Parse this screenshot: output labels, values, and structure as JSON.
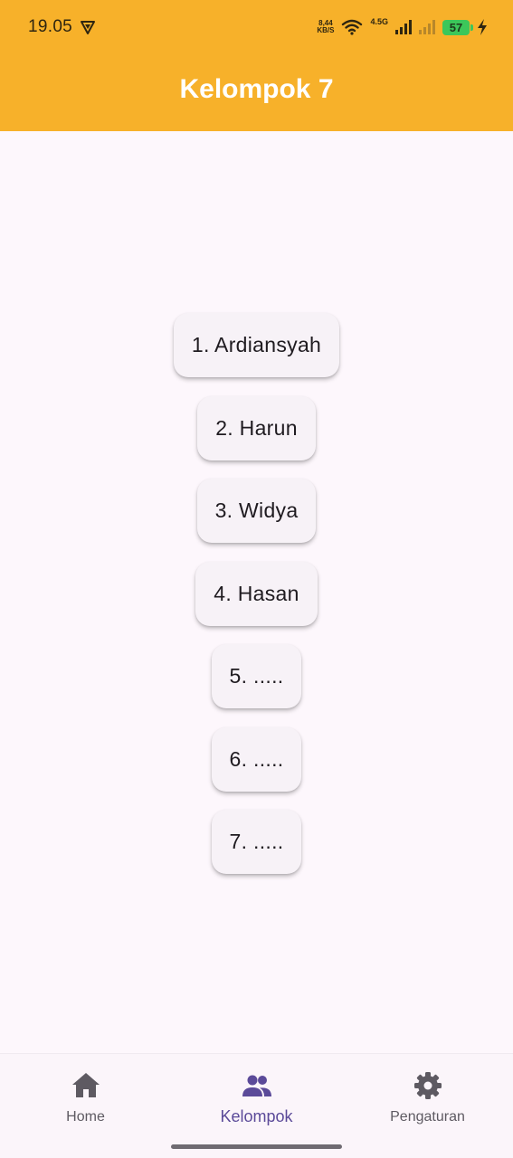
{
  "status_bar": {
    "time": "19.05",
    "net_speed_value": "8,44",
    "net_speed_unit": "KB/S",
    "network_type": "4.5G",
    "battery_level": "57",
    "icons": [
      "vpn-shield-icon",
      "wifi-icon",
      "signal-icon",
      "signal-weak-icon",
      "battery-icon",
      "charging-bolt-icon"
    ]
  },
  "app_bar": {
    "title": "Kelompok 7",
    "background_color": "#f7b12a"
  },
  "members": [
    {
      "label": "1. Ardiansyah"
    },
    {
      "label": "2. Harun"
    },
    {
      "label": "3. Widya"
    },
    {
      "label": "4. Hasan"
    },
    {
      "label": "5. ....."
    },
    {
      "label": "6. ....."
    },
    {
      "label": "7. ....."
    }
  ],
  "bottom_nav": {
    "items": [
      {
        "label": "Home",
        "icon": "home-icon",
        "active": false
      },
      {
        "label": "Kelompok",
        "icon": "group-icon",
        "active": true
      },
      {
        "label": "Pengaturan",
        "icon": "settings-gear-icon",
        "active": false
      }
    ],
    "active_color": "#5b4a99",
    "inactive_color": "#5e5a62"
  }
}
